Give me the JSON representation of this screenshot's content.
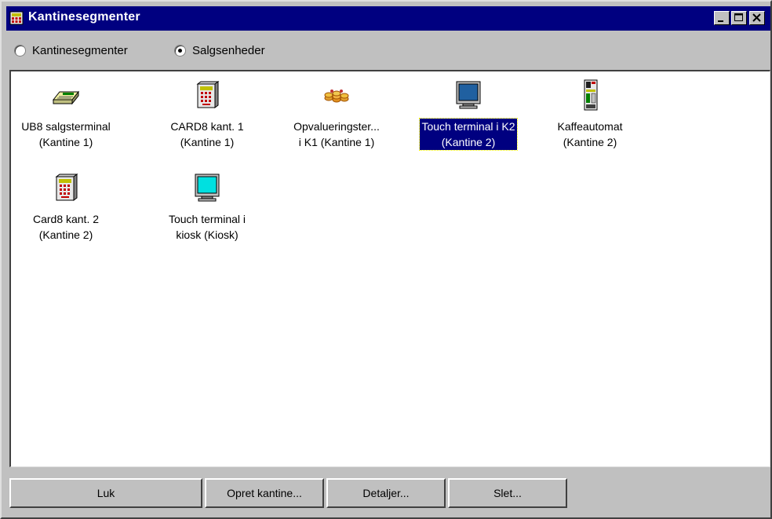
{
  "window": {
    "title": "Kantinesegmenter",
    "icon": "app-grid-icon"
  },
  "view_mode": {
    "options": [
      {
        "label": "Kantinesegmenter",
        "selected": false
      },
      {
        "label": "Salgsenheder",
        "selected": true
      }
    ]
  },
  "items": [
    {
      "label": "UB8 salgsterminal\n(Kantine 1)",
      "icon": "keypad-terminal-icon",
      "selected": false
    },
    {
      "label": "CARD8 kant. 1\n(Kantine 1)",
      "icon": "card-reader-icon",
      "selected": false
    },
    {
      "label": "Opvalueringster...\ni K1 (Kantine 1)",
      "icon": "coins-icon",
      "selected": false
    },
    {
      "label": "Touch terminal i K2\n(Kantine 2)",
      "icon": "monitor-icon",
      "selected": true
    },
    {
      "label": "Kaffeautomat\n(Kantine 2)",
      "icon": "coffee-machine-icon",
      "selected": false
    },
    {
      "label": "Card8 kant. 2\n(Kantine 2)",
      "icon": "card-reader-icon",
      "selected": false
    },
    {
      "label": "Touch terminal i\nkiosk (Kiosk)",
      "icon": "monitor-icon",
      "selected": false
    }
  ],
  "buttons": {
    "close_label": "Luk",
    "create_label": "Opret kantine...",
    "details_label": "Detaljer...",
    "delete_label": "Slet..."
  },
  "colors": {
    "titlebar": "#000080",
    "face": "#c0c0c0",
    "selection": "#000080"
  }
}
